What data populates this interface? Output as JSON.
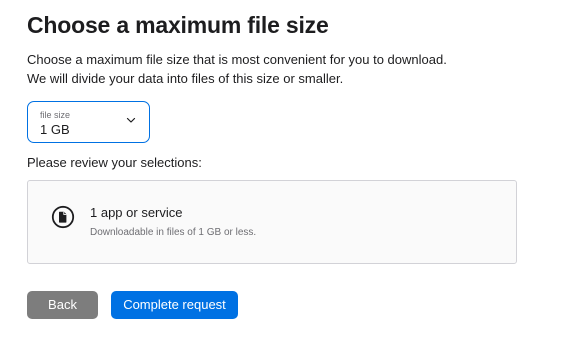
{
  "heading": {
    "title": "Choose a maximum file size",
    "description_line1": "Choose a maximum file size that is most convenient for you to download.",
    "description_line2": "We will divide your data into files of this size or smaller."
  },
  "file_size_select": {
    "label": "file size",
    "value": "1 GB",
    "icon": "chevron-down-icon"
  },
  "review": {
    "label": "Please review your selections:",
    "items": [
      {
        "icon": "document-icon",
        "title": "1 app or service",
        "subtitle": "Downloadable in files of 1 GB or less."
      }
    ]
  },
  "actions": {
    "back_label": "Back",
    "complete_label": "Complete request"
  },
  "colors": {
    "accent": "#0071e3",
    "secondary_button": "#7d7d7d",
    "text": "#1d1d1f",
    "muted_text": "#6e6e73",
    "border": "#d2d2d7"
  }
}
